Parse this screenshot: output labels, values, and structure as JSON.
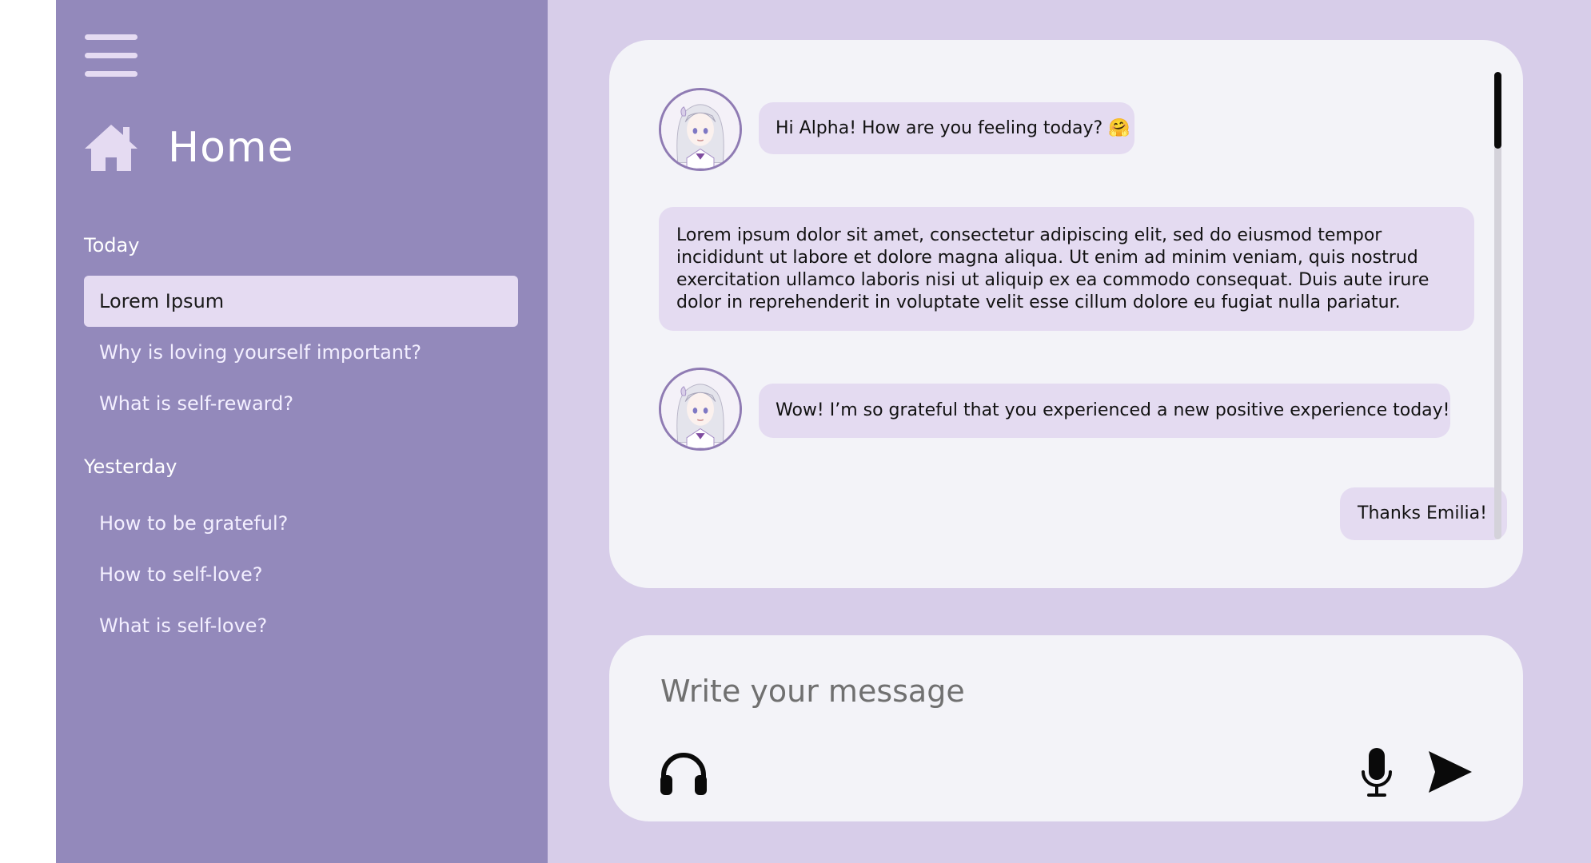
{
  "sidebar": {
    "home_label": "Home",
    "sections": [
      {
        "title": "Today",
        "items": [
          {
            "label": "Lorem Ipsum"
          },
          {
            "label": "Why is loving yourself important?"
          },
          {
            "label": "What is self-reward?"
          }
        ]
      },
      {
        "title": "Yesterday",
        "items": [
          {
            "label": "How to be grateful?"
          },
          {
            "label": "How to self-love?"
          },
          {
            "label": "What is self-love?"
          }
        ]
      }
    ]
  },
  "chat": {
    "messages": [
      {
        "sender": "bot",
        "text": "Hi Alpha! How are you feeling today? 🤗"
      },
      {
        "sender": "user",
        "text": "Lorem ipsum dolor sit amet, consectetur adipiscing elit, sed do eiusmod tempor incididunt ut labore et dolore magna aliqua. Ut enim ad minim veniam, quis nostrud exercitation ullamco laboris nisi ut aliquip ex ea commodo consequat. Duis aute irure dolor in reprehenderit in voluptate velit esse cillum dolore eu fugiat nulla pariatur."
      },
      {
        "sender": "bot",
        "text": "Wow! I’m so grateful that you experienced a new positive experience today!"
      },
      {
        "sender": "user",
        "text": "Thanks Emilia!"
      }
    ]
  },
  "composer": {
    "placeholder": "Write your message",
    "value": ""
  },
  "icons": {
    "menu": "hamburger-menu-icon",
    "home": "home-icon",
    "avatar": "character-avatar-icon",
    "headphones": "headphones-icon",
    "microphone": "microphone-icon",
    "send": "send-icon"
  },
  "colors": {
    "sidebar_bg": "#9389bb",
    "main_bg": "#d7cde9",
    "card_bg": "#f3f3f8",
    "bubble_bg": "#e4dbf1",
    "active_item_bg": "#e5dbf2"
  }
}
